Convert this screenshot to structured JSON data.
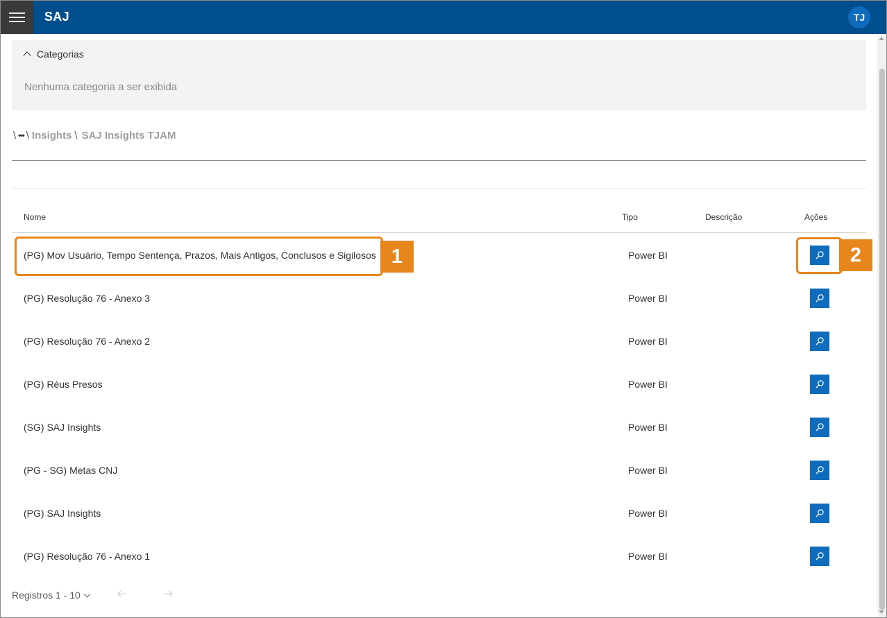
{
  "topbar": {
    "app_title": "SAJ",
    "user_initials": "TJ",
    "colors": {
      "bar": "#004e8c",
      "menu": "#3b3a39",
      "avatar": "#0f6cbd"
    }
  },
  "categories": {
    "title": "Categorias",
    "empty_message": "Nenhuma categoria a ser exibida"
  },
  "breadcrumb": {
    "root_sep": "\\",
    "collapsed": "•••",
    "items": [
      "Insights"
    ],
    "current": "SAJ Insights TJAM"
  },
  "table": {
    "headers": {
      "name": "Nome",
      "type": "Tipo",
      "description": "Descrição",
      "actions": "Ações"
    },
    "rows": [
      {
        "name": "(PG) Mov Usuário, Tempo Sentença, Prazos, Mais Antigos, Conclusos e Sigilosos",
        "type": "Power BI",
        "description": ""
      },
      {
        "name": "(PG) Resolução 76 - Anexo 3",
        "type": "Power BI",
        "description": ""
      },
      {
        "name": "(PG) Resolução 76 - Anexo 2",
        "type": "Power BI",
        "description": ""
      },
      {
        "name": "(PG) Réus Presos",
        "type": "Power BI",
        "description": ""
      },
      {
        "name": "(SG) SAJ Insights",
        "type": "Power BI",
        "description": ""
      },
      {
        "name": "(PG - SG) Metas CNJ",
        "type": "Power BI",
        "description": ""
      },
      {
        "name": "(PG) SAJ Insights",
        "type": "Power BI",
        "description": ""
      },
      {
        "name": "(PG) Resolução 76 - Anexo 1",
        "type": "Power BI",
        "description": ""
      }
    ],
    "action_icon": "search-icon",
    "action_color": "#0f6cbd"
  },
  "annotations": {
    "callout_1": "1",
    "callout_2": "2",
    "color": "#e6861c"
  },
  "pagination": {
    "label": "Registros 1 - 10"
  }
}
